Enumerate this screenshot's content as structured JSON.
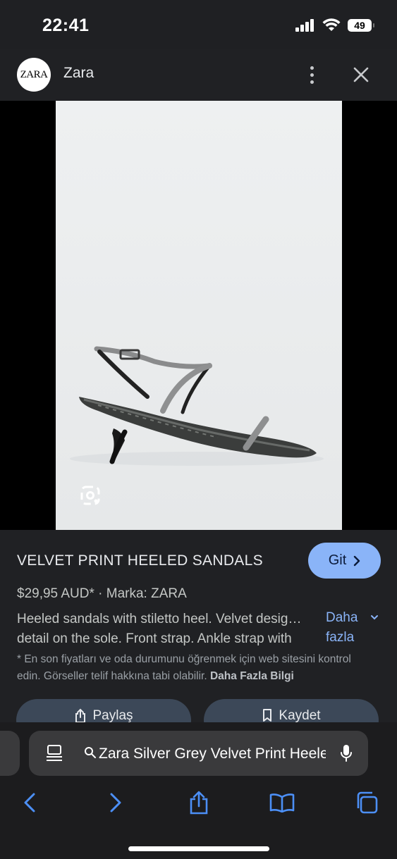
{
  "status": {
    "time": "22:41",
    "battery": "49"
  },
  "header": {
    "logo_text": "ZARA",
    "site_name": "Zara"
  },
  "product": {
    "title": "VELVET PRINT HEELED SANDALS",
    "go_button": "Git",
    "price": "$29,95 AUD*",
    "brand": "Marka: ZARA",
    "description_line1": "Heeled sandals with stiletto heel. Velvet desig…",
    "description_line2": "detail on the sole. Front strap. Ankle strap with",
    "more_line1": "Daha",
    "more_line2": "fazla",
    "note": "* En son fiyatları ve oda durumunu öğrenmek için web sitesini kontrol edin. Görseller telif hakkına tabi olabilir.",
    "note_link": "Daha Fazla Bilgi",
    "share_button": "Paylaş",
    "save_button": "Kaydet"
  },
  "browser": {
    "url_text": "Zara Silver Grey Velvet Print Heeled Sandals"
  },
  "colors": {
    "accent": "#8ab4f8",
    "background": "#202124",
    "button": "#3c4858"
  }
}
